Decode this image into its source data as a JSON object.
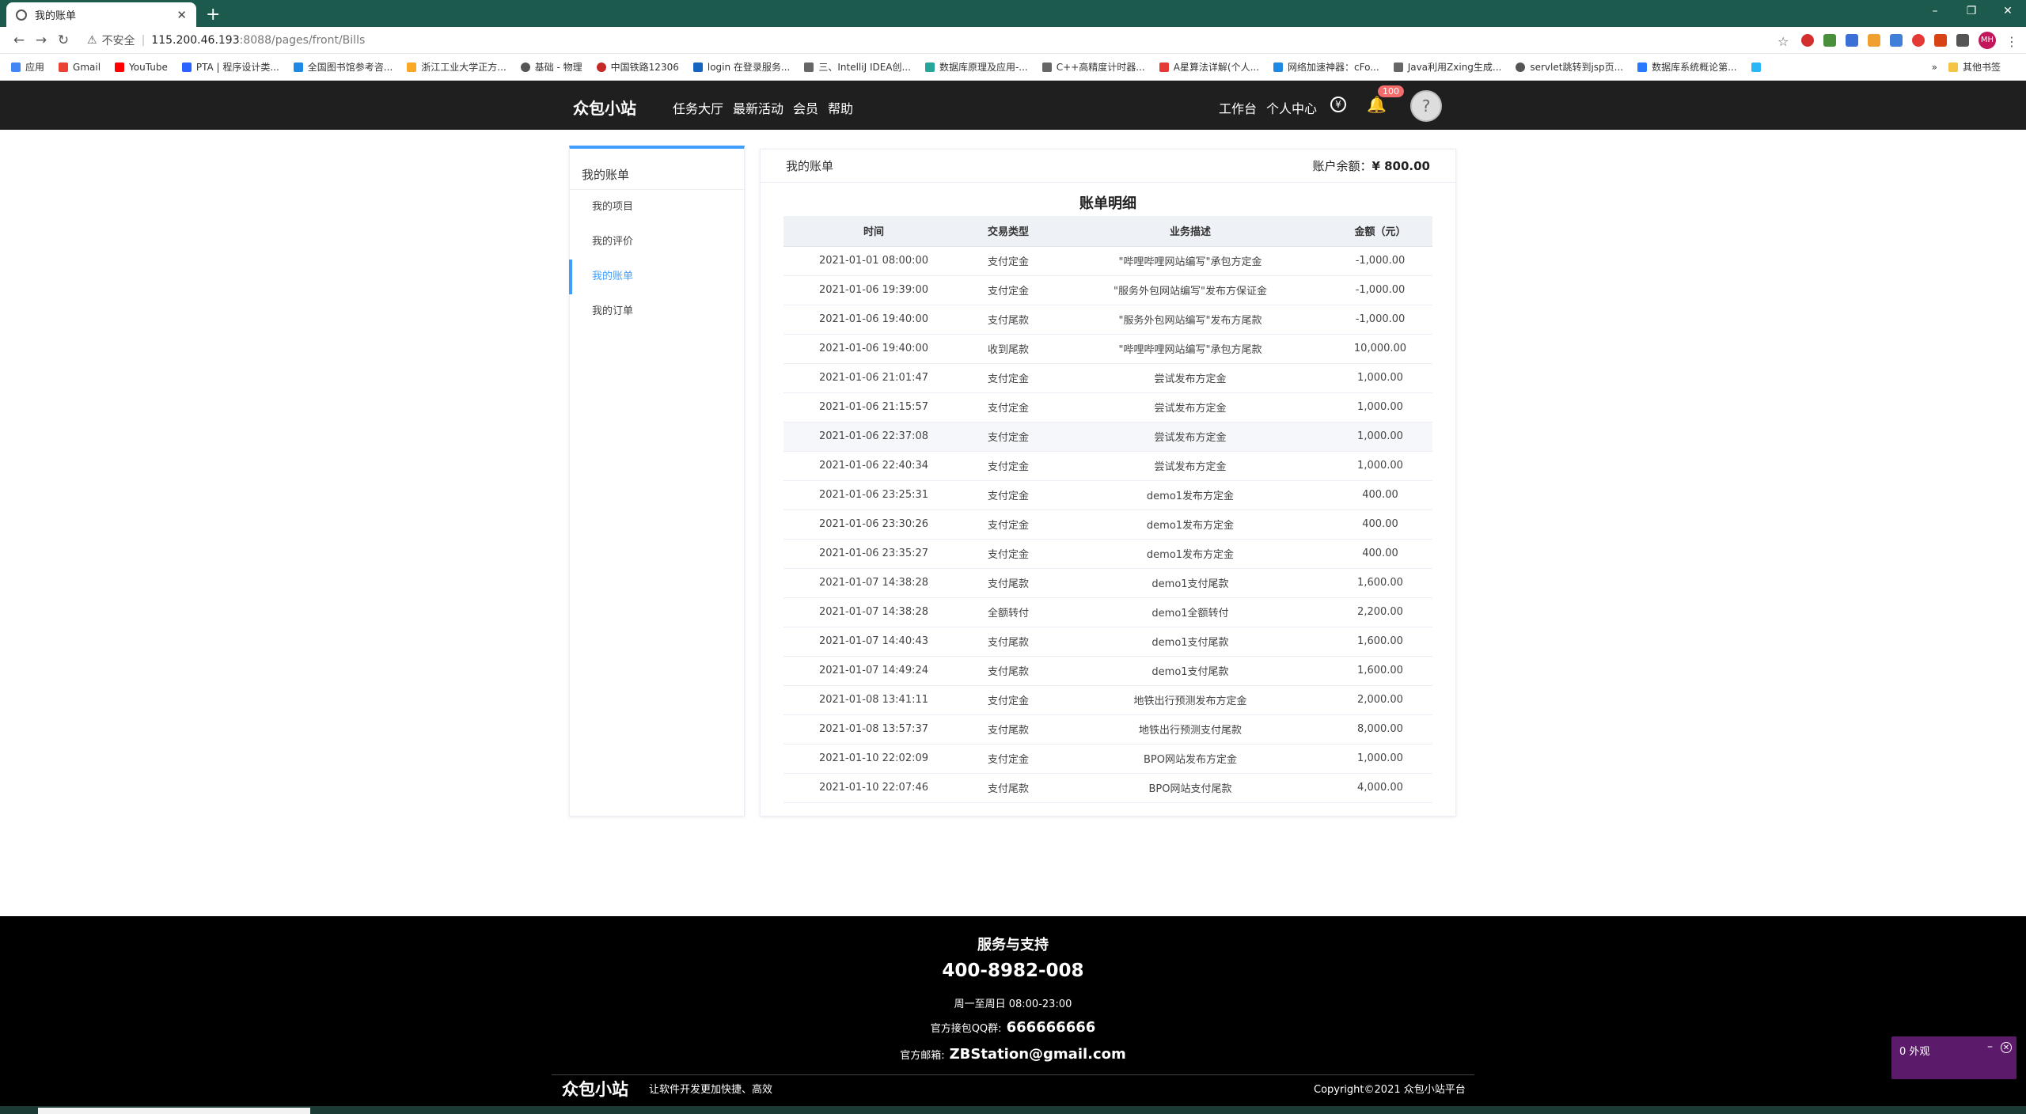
{
  "browser": {
    "tab_title": "我的账单",
    "new_tab": "+",
    "window_controls": [
      "–",
      "❐",
      "✕"
    ],
    "insecure_label": "不安全",
    "url_host": "115.200.46.193",
    "url_path": ":8088/pages/front/Bills",
    "profile_initials": "MH",
    "bookmarks": [
      "应用",
      "Gmail",
      "YouTube",
      "PTA | 程序设计类...",
      "全国图书馆参考咨...",
      "浙江工业大学正方...",
      "基础 - 物理",
      "中国铁路12306",
      "login 在登录服务...",
      "三、IntelliJ IDEA创...",
      "数据库原理及应用-...",
      "C++高精度计时器...",
      "A星算法详解(个人...",
      "网络加速神器：cFo...",
      "Java利用Zxing生成...",
      "servlet跳转到jsp页...",
      "数据库系统概论第..."
    ],
    "other_bookmarks": "其他书签",
    "bookmark_more": "»"
  },
  "header": {
    "logo": "众包小站",
    "nav": [
      "任务大厅",
      "最新活动",
      "会员",
      "帮助"
    ],
    "right_nav": [
      "工作台",
      "个人中心"
    ],
    "yuan_symbol": "¥",
    "notification_count": "100"
  },
  "sidebar": {
    "title": "我的账单",
    "items": [
      {
        "label": "我的项目"
      },
      {
        "label": "我的评价"
      },
      {
        "label": "我的账单"
      },
      {
        "label": "我的订单"
      }
    ]
  },
  "panel": {
    "title": "我的账单",
    "balance_label": "账户余额：",
    "balance_value": "¥ 800.00",
    "table_title": "账单明细",
    "columns": [
      "时间",
      "交易类型",
      "业务描述",
      "金额（元）"
    ],
    "rows": [
      [
        "2021-01-01 08:00:00",
        "支付定金",
        "\"哔哩哔哩网站编写\"承包方定金",
        "-1,000.00"
      ],
      [
        "2021-01-06 19:39:00",
        "支付定金",
        "\"服务外包网站编写\"发布方保证金",
        "-1,000.00"
      ],
      [
        "2021-01-06 19:40:00",
        "支付尾款",
        "\"服务外包网站编写\"发布方尾款",
        "-1,000.00"
      ],
      [
        "2021-01-06 19:40:00",
        "收到尾款",
        "\"哔哩哔哩网站编写\"承包方尾款",
        "10,000.00"
      ],
      [
        "2021-01-06 21:01:47",
        "支付定金",
        "尝试发布方定金",
        "1,000.00"
      ],
      [
        "2021-01-06 21:15:57",
        "支付定金",
        "尝试发布方定金",
        "1,000.00"
      ],
      [
        "2021-01-06 22:37:08",
        "支付定金",
        "尝试发布方定金",
        "1,000.00"
      ],
      [
        "2021-01-06 22:40:34",
        "支付定金",
        "尝试发布方定金",
        "1,000.00"
      ],
      [
        "2021-01-06 23:25:31",
        "支付定金",
        "demo1发布方定金",
        "400.00"
      ],
      [
        "2021-01-06 23:30:26",
        "支付定金",
        "demo1发布方定金",
        "400.00"
      ],
      [
        "2021-01-06 23:35:27",
        "支付定金",
        "demo1发布方定金",
        "400.00"
      ],
      [
        "2021-01-07 14:38:28",
        "支付尾款",
        "demo1支付尾款",
        "1,600.00"
      ],
      [
        "2021-01-07 14:38:28",
        "全额转付",
        "demo1全额转付",
        "2,200.00"
      ],
      [
        "2021-01-07 14:40:43",
        "支付尾款",
        "demo1支付尾款",
        "1,600.00"
      ],
      [
        "2021-01-07 14:49:24",
        "支付尾款",
        "demo1支付尾款",
        "1,600.00"
      ],
      [
        "2021-01-08 13:41:11",
        "支付定金",
        "地铁出行预测发布方定金",
        "2,000.00"
      ],
      [
        "2021-01-08 13:57:37",
        "支付尾款",
        "地铁出行预测支付尾款",
        "8,000.00"
      ],
      [
        "2021-01-10 22:02:09",
        "支付定金",
        "BPO网站发布方定金",
        "1,000.00"
      ],
      [
        "2021-01-10 22:07:46",
        "支付尾款",
        "BPO网站支付尾款",
        "4,000.00"
      ]
    ]
  },
  "footer": {
    "title": "服务与支持",
    "phone": "400-8982-008",
    "hours": "周一至周日 08:00-23:00",
    "qq_label": "官方接包QQ群:",
    "qq_value": "666666666",
    "mail_label": "官方邮箱:",
    "mail_value": "ZBStation@gmail.com",
    "logo": "众包小站",
    "slogan": "让软件开发更加快捷、高效",
    "copyright": "Copyright©2021 众包小站平台"
  },
  "widget": {
    "text": "0 外观",
    "minimize": "–",
    "close": "✕"
  },
  "colors": {
    "accent": "#409eff",
    "header_bg": "#1f1f1f",
    "footer_bg": "#000000",
    "browser_frame": "#1d5a4e",
    "badge": "#f56c6c"
  }
}
